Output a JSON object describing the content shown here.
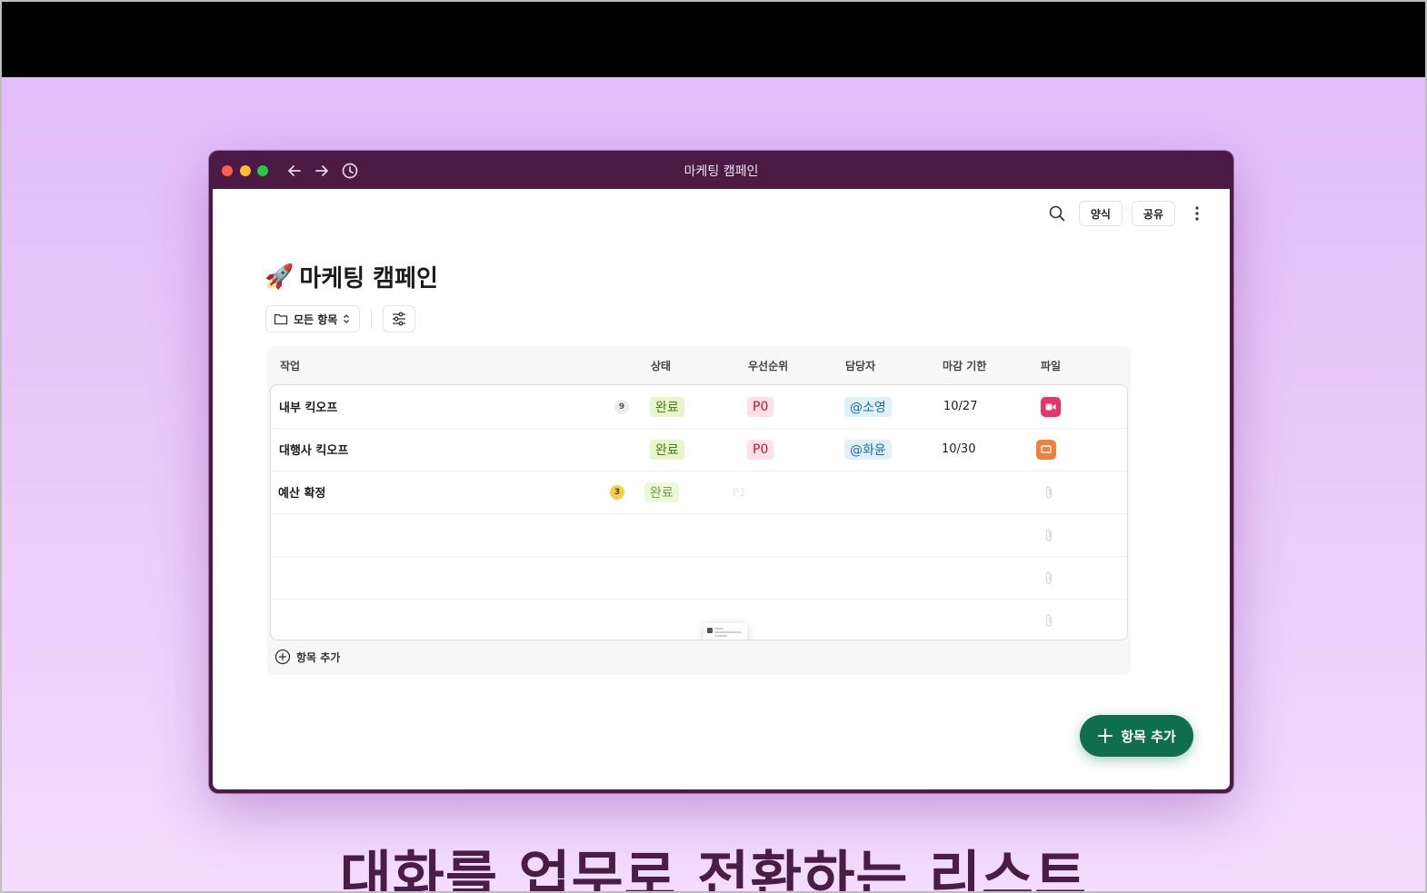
{
  "window": {
    "title": "마케팅 캠페인"
  },
  "toolbar": {
    "template_label": "양식",
    "share_label": "공유"
  },
  "page": {
    "emoji": "🚀",
    "title": "마케팅 캠페인"
  },
  "view": {
    "label": "모든 항목"
  },
  "table": {
    "headers": {
      "task": "작업",
      "status": "상태",
      "priority": "우선순위",
      "assignee": "담당자",
      "due": "마감 기한",
      "file": "파일"
    },
    "rows": [
      {
        "task": "내부 킥오프",
        "count": "9",
        "status": "완료",
        "priority": "P0",
        "assignee": "@소영",
        "due": "10/27",
        "file_icon": "video-icon",
        "file_color": "#e8336b"
      },
      {
        "task": "대행사 킥오프",
        "count": "",
        "status": "완료",
        "priority": "P0",
        "assignee": "@화윤",
        "due": "10/30",
        "file_icon": "slides-icon",
        "file_color": "#f0813a"
      },
      {
        "task": "예산 확정",
        "count": "3",
        "status": "완료",
        "priority": "P1",
        "assignee": "",
        "due": "",
        "file_icon": "",
        "file_color": ""
      }
    ],
    "add_item_label": "항목 추가"
  },
  "fab": {
    "label": "항목 추가"
  },
  "caption": "대화를 업무로 전환하는 리스트",
  "colors": {
    "window": "#4b1a45",
    "fab": "#0e6e4d",
    "status_bg": "#e6f6c9",
    "priority_bg": "#fde1e6",
    "person_bg": "#dff0fb"
  }
}
